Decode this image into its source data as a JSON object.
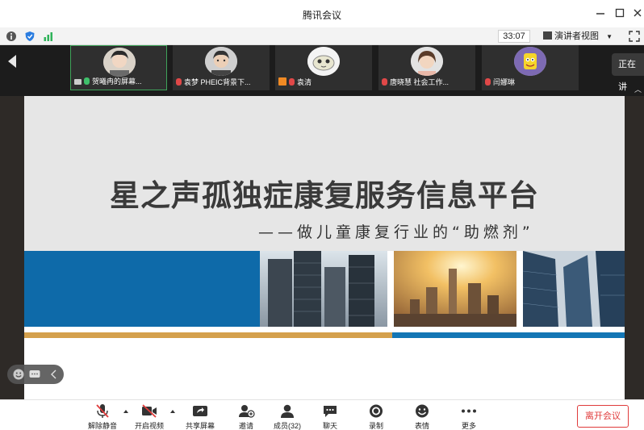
{
  "window": {
    "title": "腾讯会议"
  },
  "status": {
    "timer": "33:07",
    "view_mode": "演讲者视图"
  },
  "participants": [
    {
      "name": "贺曦冉的屏幕..."
    },
    {
      "name": "袁梦 PHEIC背景下..."
    },
    {
      "name": "袁清"
    },
    {
      "name": "唐晓慧  社会工作..."
    },
    {
      "name": "闫娜琳"
    }
  ],
  "speaking_label": "正在讲",
  "slide": {
    "title": "星之声孤独症康复服务信息平台",
    "subtitle": "——做儿童康复行业的“助燃剂”"
  },
  "toolbar": {
    "unmute": "解除静音",
    "video": "开启视频",
    "share": "共享屏幕",
    "invite": "邀请",
    "members": "成员(32)",
    "chat": "聊天",
    "record": "录制",
    "reactions": "表情",
    "more": "更多",
    "leave": "离开会议"
  },
  "colors": {
    "accent_blue": "#0e6aa9",
    "gold": "#d4a04c",
    "leave_red": "#e03b3b",
    "active_green": "#3fa35a"
  }
}
